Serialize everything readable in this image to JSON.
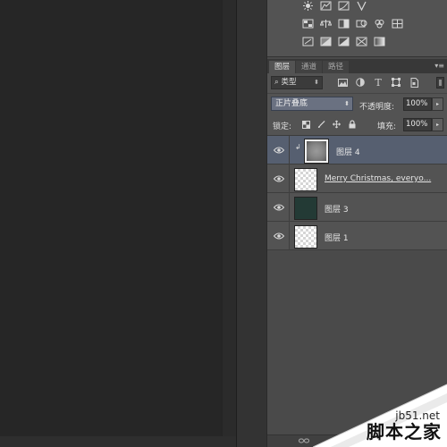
{
  "layers_panel": {
    "tabs": [
      {
        "label": "图层"
      },
      {
        "label": "通道"
      },
      {
        "label": "路径"
      }
    ],
    "filter": {
      "kind_label": "类型",
      "icons": [
        "image-filter-icon",
        "adjustment-filter-icon",
        "text-filter-icon",
        "shape-filter-icon",
        "smart-object-filter-icon"
      ]
    },
    "blend_mode": "正片叠底",
    "opacity_label": "不透明度:",
    "opacity_value": "100%",
    "lock_label": "锁定:",
    "fill_label": "填充:",
    "fill_value": "100%",
    "layers": [
      {
        "name": "图层 4",
        "thumb": "noise",
        "selected": true,
        "clipped": true
      },
      {
        "name": "Merry Christmas, everyo...",
        "thumb": "transparent",
        "selected": false,
        "text_layer": true
      },
      {
        "name": "图层 3",
        "thumb": "dark-green",
        "selected": false
      },
      {
        "name": "图层 1",
        "thumb": "transparent",
        "selected": false
      }
    ]
  },
  "watermark": {
    "url": "jb51.net",
    "site_name": "脚本之家"
  },
  "colors": {
    "panel_bg": "#535353",
    "selected_layer": "#565f70",
    "canvas_bg": "#262626",
    "blend_select": "#6a7181"
  }
}
